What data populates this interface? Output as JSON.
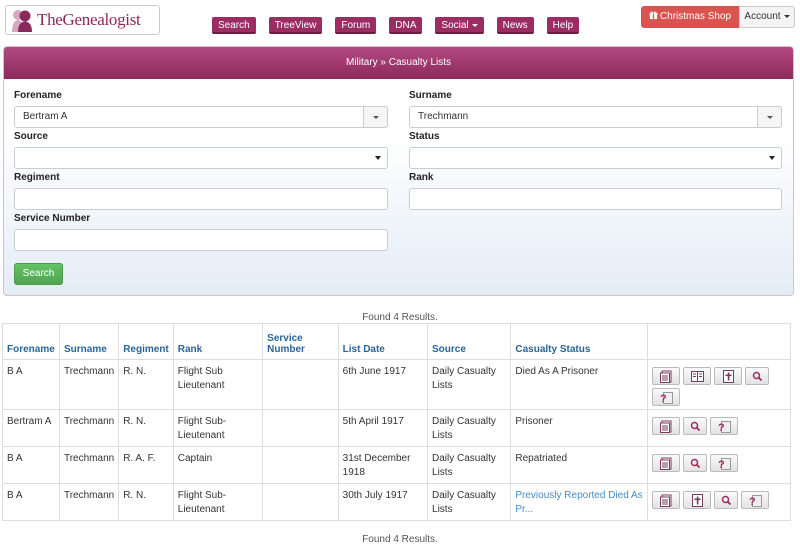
{
  "header": {
    "logo_text": "TheGenealogist",
    "nav": [
      {
        "label": "Search",
        "name": "nav-search"
      },
      {
        "label": "TreeView",
        "name": "nav-treeview"
      },
      {
        "label": "Forum",
        "name": "nav-forum"
      },
      {
        "label": "DNA",
        "name": "nav-dna"
      },
      {
        "label": "Social",
        "name": "nav-social",
        "dropdown": true
      },
      {
        "label": "News",
        "name": "nav-news"
      },
      {
        "label": "Help",
        "name": "nav-help"
      }
    ],
    "shop_label": "Christmas Shop",
    "account_label": "Account"
  },
  "panel": {
    "title": "Military » Casualty Lists",
    "forename_label": "Forename",
    "forename_value": "Bertram A",
    "surname_label": "Surname",
    "surname_value": "Trechmann",
    "source_label": "Source",
    "source_value": "",
    "status_label": "Status",
    "status_value": "",
    "regiment_label": "Regiment",
    "regiment_value": "",
    "rank_label": "Rank",
    "rank_value": "",
    "service_label": "Service Number",
    "service_value": "",
    "search_label": "Search"
  },
  "results": {
    "found_text": "Found 4 Results.",
    "columns": [
      "Forename",
      "Surname",
      "Regiment",
      "Rank",
      "Service Number",
      "List Date",
      "Source",
      "Casualty Status",
      ""
    ],
    "rows": [
      {
        "forename": "B A",
        "surname": "Trechmann",
        "regiment": "R. N.",
        "rank": "Flight Sub Lieutenant",
        "service": "",
        "date": "6th June 1917",
        "source": "Daily Casualty Lists",
        "status": "Died As A Prisoner",
        "status_link": false,
        "actions": [
          "transcript",
          "image",
          "memorial",
          "search",
          "help"
        ]
      },
      {
        "forename": "Bertram A",
        "surname": "Trechmann",
        "regiment": "R. N.",
        "rank": "Flight Sub-Lieutenant",
        "service": "",
        "date": "5th April 1917",
        "source": "Daily Casualty Lists",
        "status": "Prisoner",
        "status_link": false,
        "actions": [
          "transcript",
          "search",
          "help"
        ]
      },
      {
        "forename": "B A",
        "surname": "Trechmann",
        "regiment": "R. A. F.",
        "rank": "Captain",
        "service": "",
        "date": "31st December 1918",
        "source": "Daily Casualty Lists",
        "status": "Repatriated",
        "status_link": false,
        "actions": [
          "transcript",
          "search",
          "help"
        ]
      },
      {
        "forename": "B A",
        "surname": "Trechmann",
        "regiment": "R. N.",
        "rank": "Flight Sub-Lieutenant",
        "service": "",
        "date": "30th July 1917",
        "source": "Daily Casualty Lists",
        "status": "Previously Reported Died As Pr...",
        "status_link": true,
        "actions": [
          "transcript",
          "memorial",
          "search",
          "help"
        ]
      }
    ]
  },
  "colors": {
    "brand": "#9b2d63",
    "shop": "#d9534f",
    "search_btn": "#5cb85c",
    "link": "#428bca"
  }
}
